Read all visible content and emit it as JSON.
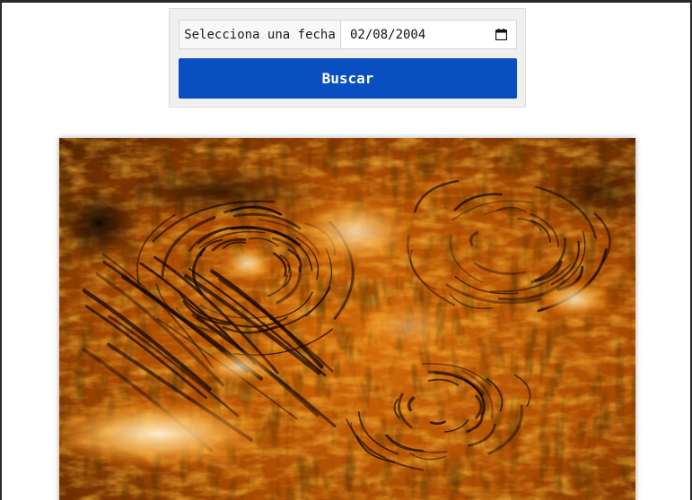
{
  "search": {
    "date_label": "Selecciona una fecha",
    "date_value": "02/08/2004",
    "button_label": "Buscar"
  },
  "image": {
    "subject": "solar surface chromosphere photo",
    "palette": {
      "dark": "#1a0800",
      "mid": "#c55a00",
      "bright": "#ff9a1a",
      "hot": "#fff2c8"
    }
  },
  "colors": {
    "accent": "#0a4fc1",
    "panel": "#f0f0f0"
  },
  "icons": {
    "calendar": "calendar-icon"
  }
}
